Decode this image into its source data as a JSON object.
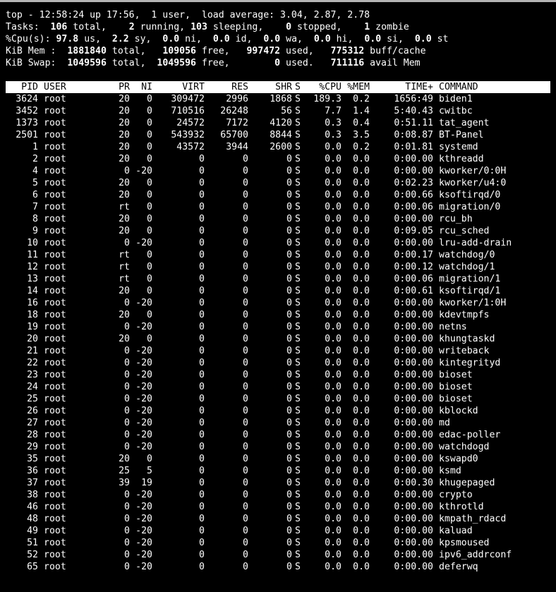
{
  "summary": {
    "top": "top - 12:58:24 up 17:56,  1 user,  load average: 3.04, 2.87, 2.78",
    "tasks": {
      "label": "Tasks:",
      "total": "106",
      "total_lbl": " total,",
      "running": "2",
      "running_lbl": " running,",
      "sleeping": "103",
      "sleeping_lbl": " sleeping,",
      "stopped": "0",
      "stopped_lbl": " stopped,",
      "zombie": "1",
      "zombie_lbl": " zombie"
    },
    "cpu": {
      "label": "%Cpu(s):",
      "us": "97.8",
      "us_lbl": " us,",
      "sy": "2.2",
      "sy_lbl": " sy,",
      "ni": "0.0",
      "ni_lbl": " ni,",
      "id": "0.0",
      "id_lbl": " id,",
      "wa": "0.0",
      "wa_lbl": " wa,",
      "hi": "0.0",
      "hi_lbl": " hi,",
      "si": "0.0",
      "si_lbl": " si,",
      "st": "0.0",
      "st_lbl": " st"
    },
    "mem": {
      "label": "KiB Mem :",
      "total": "1881840",
      "total_lbl": " total,",
      "free": "109056",
      "free_lbl": " free,",
      "used": "997472",
      "used_lbl": " used,",
      "buff": "775312",
      "buff_lbl": " buff/cache"
    },
    "swap": {
      "label": "KiB Swap:",
      "total": "1049596",
      "total_lbl": " total,",
      "free": "1049596",
      "free_lbl": " free,",
      "used": "0",
      "used_lbl": " used.",
      "avail": "711116",
      "avail_lbl": " avail Mem"
    }
  },
  "columns": [
    "PID",
    "USER",
    "PR",
    "NI",
    "VIRT",
    "RES",
    "SHR",
    "S",
    "%CPU",
    "%MEM",
    "TIME+",
    "COMMAND"
  ],
  "processes": [
    {
      "pid": "3624",
      "user": "root",
      "pr": "20",
      "ni": "0",
      "virt": "309472",
      "res": "2996",
      "shr": "1868",
      "s": "S",
      "cpu": "189.3",
      "mem": "0.2",
      "time": "1656:49",
      "cmd": "biden1"
    },
    {
      "pid": "3452",
      "user": "root",
      "pr": "20",
      "ni": "0",
      "virt": "710516",
      "res": "26248",
      "shr": "56",
      "s": "S",
      "cpu": "7.7",
      "mem": "1.4",
      "time": "5:40.43",
      "cmd": "cwitbc"
    },
    {
      "pid": "1373",
      "user": "root",
      "pr": "20",
      "ni": "0",
      "virt": "24572",
      "res": "7172",
      "shr": "4120",
      "s": "S",
      "cpu": "0.3",
      "mem": "0.4",
      "time": "0:51.11",
      "cmd": "tat_agent"
    },
    {
      "pid": "2501",
      "user": "root",
      "pr": "20",
      "ni": "0",
      "virt": "543932",
      "res": "65700",
      "shr": "8844",
      "s": "S",
      "cpu": "0.3",
      "mem": "3.5",
      "time": "0:08.87",
      "cmd": "BT-Panel"
    },
    {
      "pid": "1",
      "user": "root",
      "pr": "20",
      "ni": "0",
      "virt": "43572",
      "res": "3944",
      "shr": "2600",
      "s": "S",
      "cpu": "0.0",
      "mem": "0.2",
      "time": "0:01.81",
      "cmd": "systemd"
    },
    {
      "pid": "2",
      "user": "root",
      "pr": "20",
      "ni": "0",
      "virt": "0",
      "res": "0",
      "shr": "0",
      "s": "S",
      "cpu": "0.0",
      "mem": "0.0",
      "time": "0:00.00",
      "cmd": "kthreadd"
    },
    {
      "pid": "4",
      "user": "root",
      "pr": "0",
      "ni": "-20",
      "virt": "0",
      "res": "0",
      "shr": "0",
      "s": "S",
      "cpu": "0.0",
      "mem": "0.0",
      "time": "0:00.00",
      "cmd": "kworker/0:0H"
    },
    {
      "pid": "5",
      "user": "root",
      "pr": "20",
      "ni": "0",
      "virt": "0",
      "res": "0",
      "shr": "0",
      "s": "S",
      "cpu": "0.0",
      "mem": "0.0",
      "time": "0:02.23",
      "cmd": "kworker/u4:0"
    },
    {
      "pid": "6",
      "user": "root",
      "pr": "20",
      "ni": "0",
      "virt": "0",
      "res": "0",
      "shr": "0",
      "s": "S",
      "cpu": "0.0",
      "mem": "0.0",
      "time": "0:00.66",
      "cmd": "ksoftirqd/0"
    },
    {
      "pid": "7",
      "user": "root",
      "pr": "rt",
      "ni": "0",
      "virt": "0",
      "res": "0",
      "shr": "0",
      "s": "S",
      "cpu": "0.0",
      "mem": "0.0",
      "time": "0:00.06",
      "cmd": "migration/0"
    },
    {
      "pid": "8",
      "user": "root",
      "pr": "20",
      "ni": "0",
      "virt": "0",
      "res": "0",
      "shr": "0",
      "s": "S",
      "cpu": "0.0",
      "mem": "0.0",
      "time": "0:00.00",
      "cmd": "rcu_bh"
    },
    {
      "pid": "9",
      "user": "root",
      "pr": "20",
      "ni": "0",
      "virt": "0",
      "res": "0",
      "shr": "0",
      "s": "S",
      "cpu": "0.0",
      "mem": "0.0",
      "time": "0:09.05",
      "cmd": "rcu_sched"
    },
    {
      "pid": "10",
      "user": "root",
      "pr": "0",
      "ni": "-20",
      "virt": "0",
      "res": "0",
      "shr": "0",
      "s": "S",
      "cpu": "0.0",
      "mem": "0.0",
      "time": "0:00.00",
      "cmd": "lru-add-drain"
    },
    {
      "pid": "11",
      "user": "root",
      "pr": "rt",
      "ni": "0",
      "virt": "0",
      "res": "0",
      "shr": "0",
      "s": "S",
      "cpu": "0.0",
      "mem": "0.0",
      "time": "0:00.17",
      "cmd": "watchdog/0"
    },
    {
      "pid": "12",
      "user": "root",
      "pr": "rt",
      "ni": "0",
      "virt": "0",
      "res": "0",
      "shr": "0",
      "s": "S",
      "cpu": "0.0",
      "mem": "0.0",
      "time": "0:00.12",
      "cmd": "watchdog/1"
    },
    {
      "pid": "13",
      "user": "root",
      "pr": "rt",
      "ni": "0",
      "virt": "0",
      "res": "0",
      "shr": "0",
      "s": "S",
      "cpu": "0.0",
      "mem": "0.0",
      "time": "0:00.06",
      "cmd": "migration/1"
    },
    {
      "pid": "14",
      "user": "root",
      "pr": "20",
      "ni": "0",
      "virt": "0",
      "res": "0",
      "shr": "0",
      "s": "S",
      "cpu": "0.0",
      "mem": "0.0",
      "time": "0:00.61",
      "cmd": "ksoftirqd/1"
    },
    {
      "pid": "16",
      "user": "root",
      "pr": "0",
      "ni": "-20",
      "virt": "0",
      "res": "0",
      "shr": "0",
      "s": "S",
      "cpu": "0.0",
      "mem": "0.0",
      "time": "0:00.00",
      "cmd": "kworker/1:0H"
    },
    {
      "pid": "18",
      "user": "root",
      "pr": "20",
      "ni": "0",
      "virt": "0",
      "res": "0",
      "shr": "0",
      "s": "S",
      "cpu": "0.0",
      "mem": "0.0",
      "time": "0:00.00",
      "cmd": "kdevtmpfs"
    },
    {
      "pid": "19",
      "user": "root",
      "pr": "0",
      "ni": "-20",
      "virt": "0",
      "res": "0",
      "shr": "0",
      "s": "S",
      "cpu": "0.0",
      "mem": "0.0",
      "time": "0:00.00",
      "cmd": "netns"
    },
    {
      "pid": "20",
      "user": "root",
      "pr": "20",
      "ni": "0",
      "virt": "0",
      "res": "0",
      "shr": "0",
      "s": "S",
      "cpu": "0.0",
      "mem": "0.0",
      "time": "0:00.00",
      "cmd": "khungtaskd"
    },
    {
      "pid": "21",
      "user": "root",
      "pr": "0",
      "ni": "-20",
      "virt": "0",
      "res": "0",
      "shr": "0",
      "s": "S",
      "cpu": "0.0",
      "mem": "0.0",
      "time": "0:00.00",
      "cmd": "writeback"
    },
    {
      "pid": "22",
      "user": "root",
      "pr": "0",
      "ni": "-20",
      "virt": "0",
      "res": "0",
      "shr": "0",
      "s": "S",
      "cpu": "0.0",
      "mem": "0.0",
      "time": "0:00.00",
      "cmd": "kintegrityd"
    },
    {
      "pid": "23",
      "user": "root",
      "pr": "0",
      "ni": "-20",
      "virt": "0",
      "res": "0",
      "shr": "0",
      "s": "S",
      "cpu": "0.0",
      "mem": "0.0",
      "time": "0:00.00",
      "cmd": "bioset"
    },
    {
      "pid": "24",
      "user": "root",
      "pr": "0",
      "ni": "-20",
      "virt": "0",
      "res": "0",
      "shr": "0",
      "s": "S",
      "cpu": "0.0",
      "mem": "0.0",
      "time": "0:00.00",
      "cmd": "bioset"
    },
    {
      "pid": "25",
      "user": "root",
      "pr": "0",
      "ni": "-20",
      "virt": "0",
      "res": "0",
      "shr": "0",
      "s": "S",
      "cpu": "0.0",
      "mem": "0.0",
      "time": "0:00.00",
      "cmd": "bioset"
    },
    {
      "pid": "26",
      "user": "root",
      "pr": "0",
      "ni": "-20",
      "virt": "0",
      "res": "0",
      "shr": "0",
      "s": "S",
      "cpu": "0.0",
      "mem": "0.0",
      "time": "0:00.00",
      "cmd": "kblockd"
    },
    {
      "pid": "27",
      "user": "root",
      "pr": "0",
      "ni": "-20",
      "virt": "0",
      "res": "0",
      "shr": "0",
      "s": "S",
      "cpu": "0.0",
      "mem": "0.0",
      "time": "0:00.00",
      "cmd": "md"
    },
    {
      "pid": "28",
      "user": "root",
      "pr": "0",
      "ni": "-20",
      "virt": "0",
      "res": "0",
      "shr": "0",
      "s": "S",
      "cpu": "0.0",
      "mem": "0.0",
      "time": "0:00.00",
      "cmd": "edac-poller"
    },
    {
      "pid": "29",
      "user": "root",
      "pr": "0",
      "ni": "-20",
      "virt": "0",
      "res": "0",
      "shr": "0",
      "s": "S",
      "cpu": "0.0",
      "mem": "0.0",
      "time": "0:00.00",
      "cmd": "watchdogd"
    },
    {
      "pid": "35",
      "user": "root",
      "pr": "20",
      "ni": "0",
      "virt": "0",
      "res": "0",
      "shr": "0",
      "s": "S",
      "cpu": "0.0",
      "mem": "0.0",
      "time": "0:00.00",
      "cmd": "kswapd0"
    },
    {
      "pid": "36",
      "user": "root",
      "pr": "25",
      "ni": "5",
      "virt": "0",
      "res": "0",
      "shr": "0",
      "s": "S",
      "cpu": "0.0",
      "mem": "0.0",
      "time": "0:00.00",
      "cmd": "ksmd"
    },
    {
      "pid": "37",
      "user": "root",
      "pr": "39",
      "ni": "19",
      "virt": "0",
      "res": "0",
      "shr": "0",
      "s": "S",
      "cpu": "0.0",
      "mem": "0.0",
      "time": "0:00.30",
      "cmd": "khugepaged"
    },
    {
      "pid": "38",
      "user": "root",
      "pr": "0",
      "ni": "-20",
      "virt": "0",
      "res": "0",
      "shr": "0",
      "s": "S",
      "cpu": "0.0",
      "mem": "0.0",
      "time": "0:00.00",
      "cmd": "crypto"
    },
    {
      "pid": "46",
      "user": "root",
      "pr": "0",
      "ni": "-20",
      "virt": "0",
      "res": "0",
      "shr": "0",
      "s": "S",
      "cpu": "0.0",
      "mem": "0.0",
      "time": "0:00.00",
      "cmd": "kthrotld"
    },
    {
      "pid": "48",
      "user": "root",
      "pr": "0",
      "ni": "-20",
      "virt": "0",
      "res": "0",
      "shr": "0",
      "s": "S",
      "cpu": "0.0",
      "mem": "0.0",
      "time": "0:00.00",
      "cmd": "kmpath_rdacd"
    },
    {
      "pid": "49",
      "user": "root",
      "pr": "0",
      "ni": "-20",
      "virt": "0",
      "res": "0",
      "shr": "0",
      "s": "S",
      "cpu": "0.0",
      "mem": "0.0",
      "time": "0:00.00",
      "cmd": "kaluad"
    },
    {
      "pid": "51",
      "user": "root",
      "pr": "0",
      "ni": "-20",
      "virt": "0",
      "res": "0",
      "shr": "0",
      "s": "S",
      "cpu": "0.0",
      "mem": "0.0",
      "time": "0:00.00",
      "cmd": "kpsmoused"
    },
    {
      "pid": "52",
      "user": "root",
      "pr": "0",
      "ni": "-20",
      "virt": "0",
      "res": "0",
      "shr": "0",
      "s": "S",
      "cpu": "0.0",
      "mem": "0.0",
      "time": "0:00.00",
      "cmd": "ipv6_addrconf"
    },
    {
      "pid": "65",
      "user": "root",
      "pr": "0",
      "ni": "-20",
      "virt": "0",
      "res": "0",
      "shr": "0",
      "s": "S",
      "cpu": "0.0",
      "mem": "0.0",
      "time": "0:00.00",
      "cmd": "deferwq"
    }
  ],
  "colors": {
    "background": "#000000",
    "foreground": "#ffffff",
    "header_bg": "#ffffff",
    "header_fg": "#000000"
  }
}
